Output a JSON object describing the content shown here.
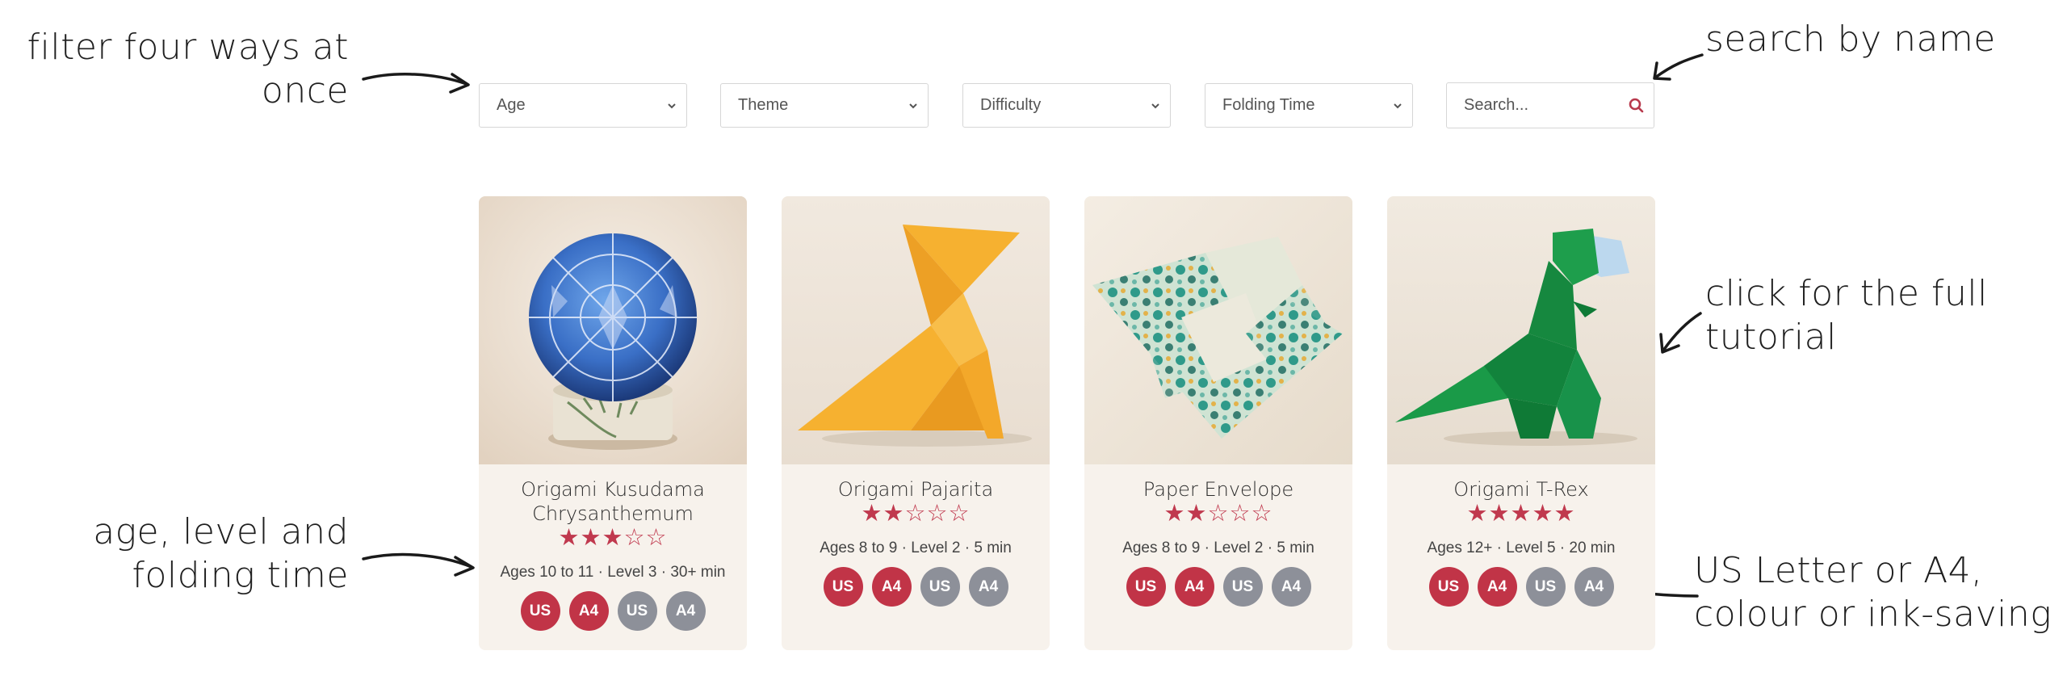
{
  "annotations": {
    "filter": "filter four ways at\nonce",
    "search": "search by name",
    "click": "click for the full\ntutorial",
    "meta": "age, level and\nfolding time",
    "paper": "US Letter or A4,\ncolour or ink-saving"
  },
  "filters": [
    {
      "label": "Age"
    },
    {
      "label": "Theme"
    },
    {
      "label": "Difficulty"
    },
    {
      "label": "Folding Time"
    }
  ],
  "search": {
    "placeholder": "Search..."
  },
  "colors": {
    "accent": "#c13447",
    "ink": "#8d9099",
    "card_bg": "#f7f2ec"
  },
  "cards": [
    {
      "title": "Origami Kusudama\nChrysanthemum",
      "rating": 3,
      "rating_max": 5,
      "stars": "★★★☆☆",
      "meta": "Ages 10 to 11 · Level 3 · 30+ min",
      "image": "blue kusudama ball on a tape roll",
      "badges": [
        {
          "label": "US",
          "style": "colour"
        },
        {
          "label": "A4",
          "style": "colour"
        },
        {
          "label": "US",
          "style": "ink"
        },
        {
          "label": "A4",
          "style": "ink"
        }
      ]
    },
    {
      "title": "Origami Pajarita",
      "rating": 2,
      "rating_max": 5,
      "stars": "★★☆☆☆",
      "meta": "Ages 8 to 9 · Level 2 · 5 min",
      "image": "yellow paper bird",
      "badges": [
        {
          "label": "US",
          "style": "colour"
        },
        {
          "label": "A4",
          "style": "colour"
        },
        {
          "label": "US",
          "style": "ink"
        },
        {
          "label": "A4",
          "style": "ink"
        }
      ]
    },
    {
      "title": "Paper Envelope",
      "rating": 2,
      "rating_max": 5,
      "stars": "★★☆☆☆",
      "meta": "Ages 8 to 9 · Level 2 · 5 min",
      "image": "floral paper envelope",
      "badges": [
        {
          "label": "US",
          "style": "colour"
        },
        {
          "label": "A4",
          "style": "colour"
        },
        {
          "label": "US",
          "style": "ink"
        },
        {
          "label": "A4",
          "style": "ink"
        }
      ]
    },
    {
      "title": "Origami T-Rex",
      "rating": 5,
      "rating_max": 5,
      "stars": "★★★★★",
      "meta": "Ages 12+ · Level 5 · 20 min",
      "image": "green paper t-rex",
      "badges": [
        {
          "label": "US",
          "style": "colour"
        },
        {
          "label": "A4",
          "style": "colour"
        },
        {
          "label": "US",
          "style": "ink"
        },
        {
          "label": "A4",
          "style": "ink"
        }
      ]
    }
  ]
}
